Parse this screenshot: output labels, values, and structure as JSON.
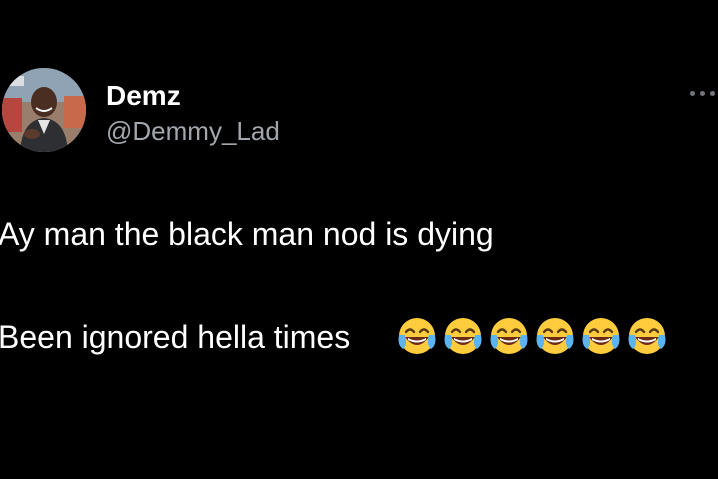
{
  "author": {
    "display_name": "Demz",
    "handle": "@Demmy_Lad",
    "avatar_icon": "profile-photo"
  },
  "menu": {
    "icon": "more-options-icon"
  },
  "tweet": {
    "line1": "Ay man the black man nod is dying",
    "line2": "Been ignored hella times",
    "emoji": "😂",
    "emoji_count": 6,
    "emoji_icon": "face-with-tears-of-joy-icon"
  },
  "colors": {
    "background": "#000000",
    "text_primary": "#ffffff",
    "text_secondary": "#a1a7ad",
    "icon_muted": "#71767b",
    "emoji_face": "#ffcc3e"
  }
}
